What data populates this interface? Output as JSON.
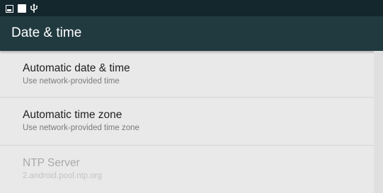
{
  "status_bar": {
    "icons": [
      "gallery-icon",
      "square-icon",
      "usb-icon"
    ],
    "background": "#13272d"
  },
  "app_bar": {
    "title": "Date & time",
    "background": "#213a40"
  },
  "settings": [
    {
      "title": "Automatic date & time",
      "subtitle": "Use network-provided time",
      "enabled": true
    },
    {
      "title": "Automatic time zone",
      "subtitle": "Use network-provided time zone",
      "enabled": true
    },
    {
      "title": "NTP Server",
      "subtitle": "2.android.pool.ntp.org",
      "enabled": false
    }
  ],
  "colors": {
    "page_background": "#e9e9e9",
    "title_text": "#ffffff",
    "item_title": "#212121",
    "item_subtitle": "#7a7a7a",
    "disabled_text": "#a9a9a9"
  }
}
